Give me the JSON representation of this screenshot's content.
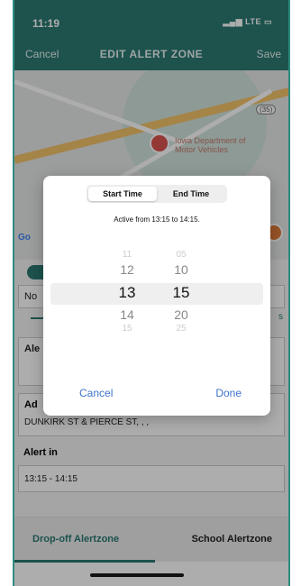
{
  "status": {
    "time": "11:19",
    "signal": "LTE"
  },
  "navbar": {
    "cancel": "Cancel",
    "title": "EDIT ALERT ZONE",
    "save": "Save"
  },
  "map": {
    "poi": "Iowa Department of Motor Vehicles",
    "shield": "(35)",
    "google": "Go"
  },
  "form": {
    "name_label": "No",
    "right_tab": "s",
    "alert_label": "Ale",
    "address_label": "Ad",
    "address_value": "DUNKIRK ST & PIERCE ST, , ,",
    "alert_in_label": "Alert in",
    "alert_in_value": "13:15 - 14:15"
  },
  "bottom_tabs": {
    "left": "Drop-off Alertzone",
    "right": "School Alertzone"
  },
  "modal": {
    "tab_start": "Start Time",
    "tab_end": "End Time",
    "active_text": "Active from 13:15 to 14:15.",
    "hours": [
      "11",
      "12",
      "13",
      "14",
      "15"
    ],
    "minutes": [
      "05",
      "10",
      "15",
      "20",
      "25"
    ],
    "cancel": "Cancel",
    "done": "Done"
  },
  "colors": {
    "accent": "#2b7a72",
    "button": "#3d74c8"
  }
}
